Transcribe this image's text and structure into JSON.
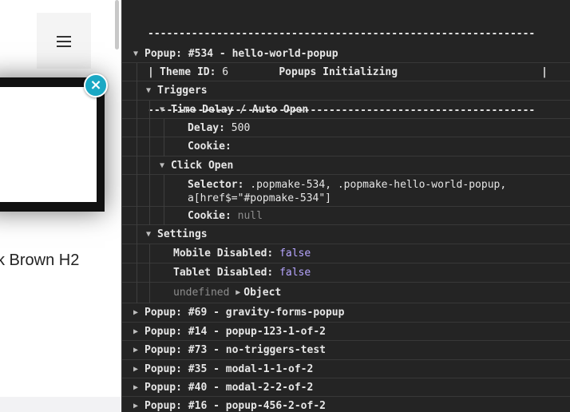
{
  "page": {
    "heading": "k Brown H2",
    "close_label": "×"
  },
  "console": {
    "banner_top": "--------------------------------------------------------------",
    "banner_mid": "|                    Popups Initializing                       |",
    "banner_bot": "--------------------------------------------------------------",
    "popup_534": {
      "title": "Popup: #534 - hello-world-popup",
      "theme_label": "Theme ID:",
      "theme_value": "6",
      "triggers_label": "Triggers",
      "time_delay_label": "Time Delay / Auto Open",
      "delay_label": "Delay:",
      "delay_value": "500",
      "cookie_label": "Cookie:",
      "click_open_label": "Click Open",
      "selector_label": "Selector:",
      "selector_value_1": ".popmake-534, .popmake-hello-world-popup,",
      "selector_value_2": "a[href$=\"#popmake-534\"]",
      "cookie2_label": "Cookie:",
      "cookie2_value": "null",
      "settings_label": "Settings",
      "mobile_label": "Mobile Disabled:",
      "mobile_value": "false",
      "tablet_label": "Tablet Disabled:",
      "tablet_value": "false",
      "undefined_label": "undefined",
      "object_label": "Object"
    },
    "other_popups": [
      "Popup: #69 - gravity-forms-popup",
      "Popup: #14 - popup-123-1-of-2",
      "Popup: #73 - no-triggers-test",
      "Popup: #35 - modal-1-1-of-2",
      "Popup: #40 - modal-2-2-of-2",
      "Popup: #16 - popup-456-2-of-2"
    ]
  }
}
